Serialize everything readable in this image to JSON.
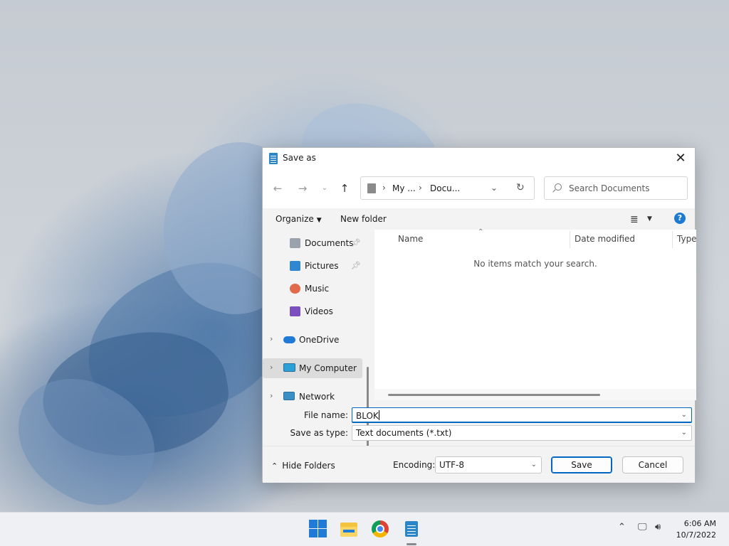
{
  "dialog": {
    "title": "Save as",
    "address": {
      "crumbs": [
        "My ...",
        "Docu..."
      ]
    },
    "search": {
      "placeholder": "Search Documents"
    },
    "commands": {
      "organize": "Organize",
      "new_folder": "New folder"
    },
    "nav_tree": [
      {
        "label": "Documents",
        "icon": "documents-icon",
        "pinned": true
      },
      {
        "label": "Pictures",
        "icon": "pictures-icon",
        "pinned": true
      },
      {
        "label": "Music",
        "icon": "music-icon",
        "pinned": false
      },
      {
        "label": "Videos",
        "icon": "videos-icon",
        "pinned": false
      },
      {
        "label": "OneDrive",
        "icon": "onedrive-icon",
        "expandable": true
      },
      {
        "label": "My Computer",
        "icon": "computer-icon",
        "expandable": true,
        "selected": true
      },
      {
        "label": "Network",
        "icon": "network-icon",
        "expandable": true
      }
    ],
    "columns": [
      "Name",
      "Date modified",
      "Type"
    ],
    "empty_message": "No items match your search.",
    "file_name_label": "File name:",
    "file_name_value": "BLOK",
    "save_type_label": "Save as type:",
    "save_type_value": "Text documents (*.txt)",
    "hide_folders": "Hide Folders",
    "encoding_label": "Encoding:",
    "encoding_value": "UTF-8",
    "save_button": "Save",
    "cancel_button": "Cancel"
  },
  "taskbar": {
    "apps": [
      "start-icon",
      "file-explorer-icon",
      "chrome-icon",
      "notepad-icon"
    ],
    "time": "6:06 AM",
    "date": "10/7/2022"
  },
  "colors": {
    "accent": "#0067c0",
    "windows_blue": "#1f7bd6"
  }
}
